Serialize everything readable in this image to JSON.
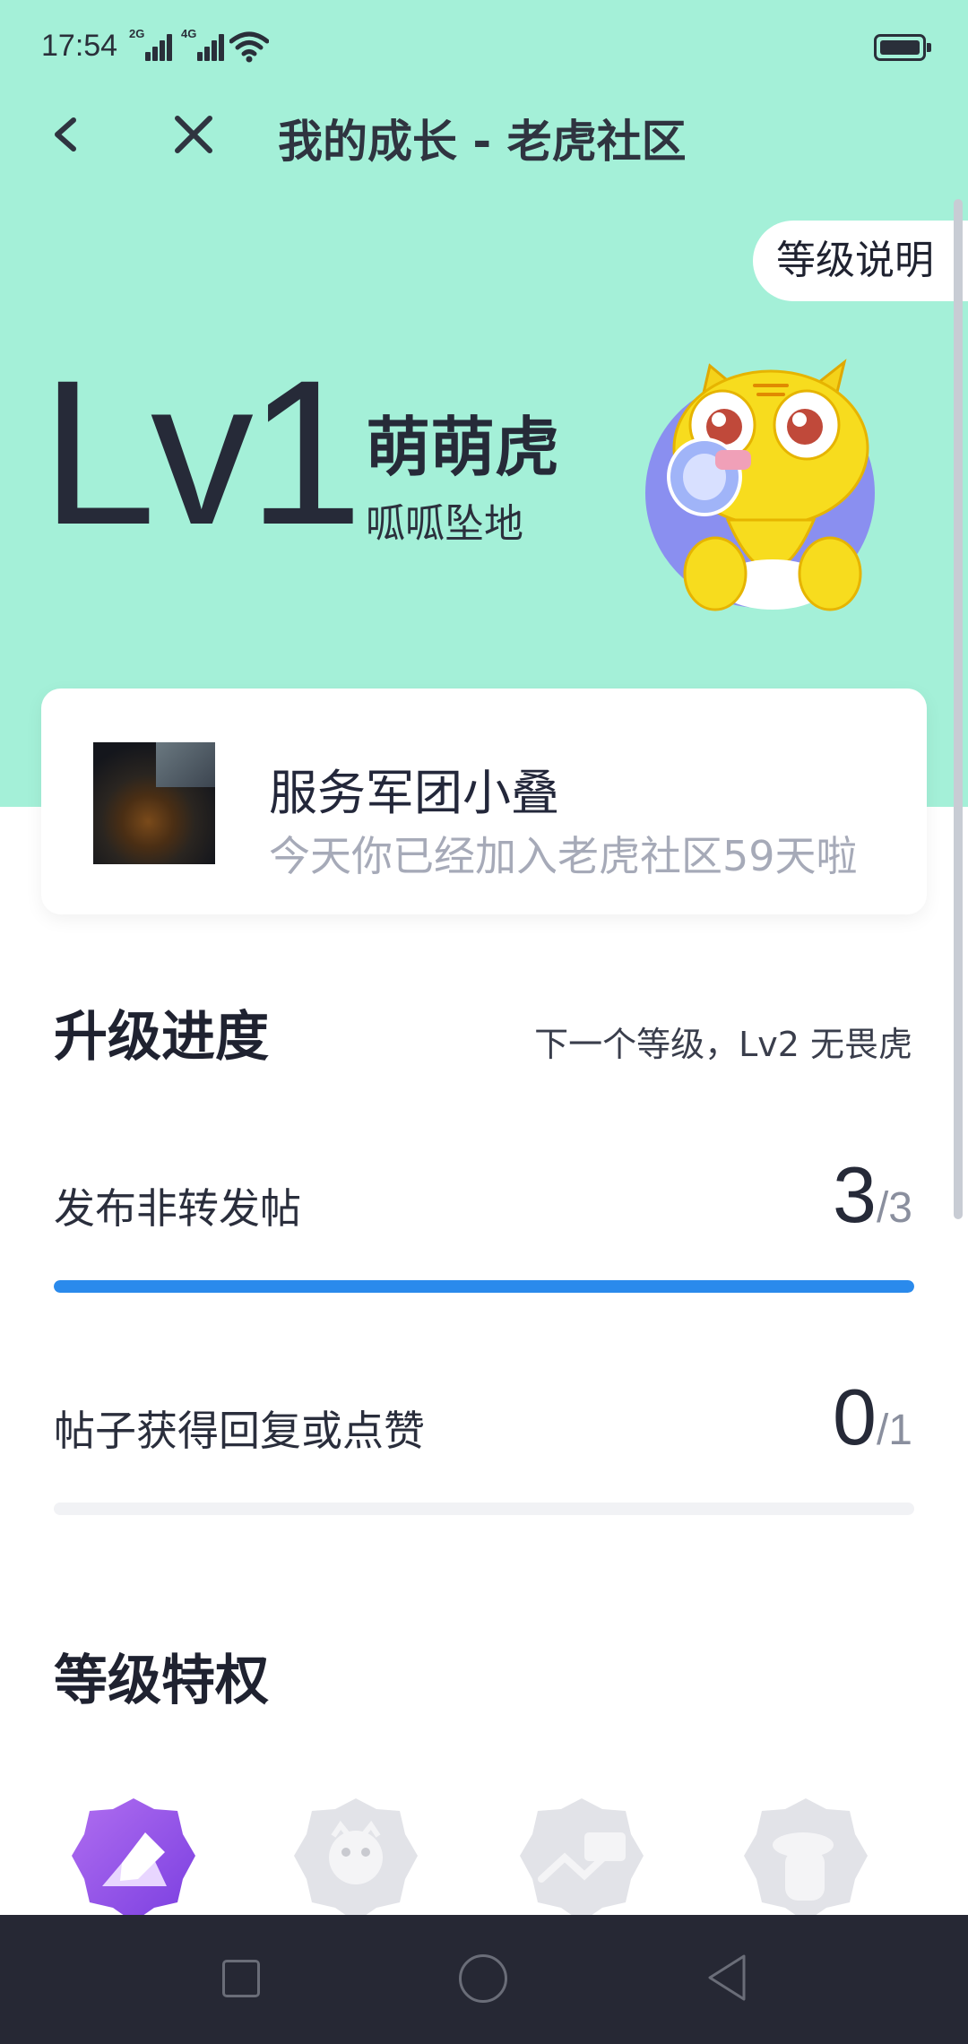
{
  "status_bar": {
    "time": "17:54",
    "sim1_tag": "2G",
    "sim2_tag": "4G"
  },
  "nav": {
    "title": "我的成长 - 老虎社区"
  },
  "level_explain_label": "等级说明",
  "level": {
    "code": "Lv1",
    "name": "萌萌虎",
    "subtitle": "呱呱坠地"
  },
  "profile": {
    "name": "服务军团小叠",
    "message": "今天你已经加入老虎社区59天啦"
  },
  "upgrade": {
    "title": "升级进度",
    "next_level": "下一个等级，Lv2 无畏虎",
    "tasks": [
      {
        "label": "发布非转发帖",
        "current": "3",
        "total": "/3",
        "progress": 1.0
      },
      {
        "label": "帖子获得回复或点赞",
        "current": "0",
        "total": "/1",
        "progress": 0.0
      }
    ]
  },
  "privileges": {
    "title": "等级特权",
    "items": [
      {
        "icon": "post-edit-badge-icon",
        "unlocked": true
      },
      {
        "icon": "tiger-avatar-badge-icon",
        "unlocked": false
      },
      {
        "icon": "trend-chart-badge-icon",
        "unlocked": false
      },
      {
        "icon": "tiger-hat-badge-icon",
        "unlocked": false
      }
    ]
  },
  "colors": {
    "mint": "#a4f0d8",
    "progress_blue": "#2a8aec",
    "track_grey": "#f1f2f5",
    "nav_dark": "#262834"
  }
}
